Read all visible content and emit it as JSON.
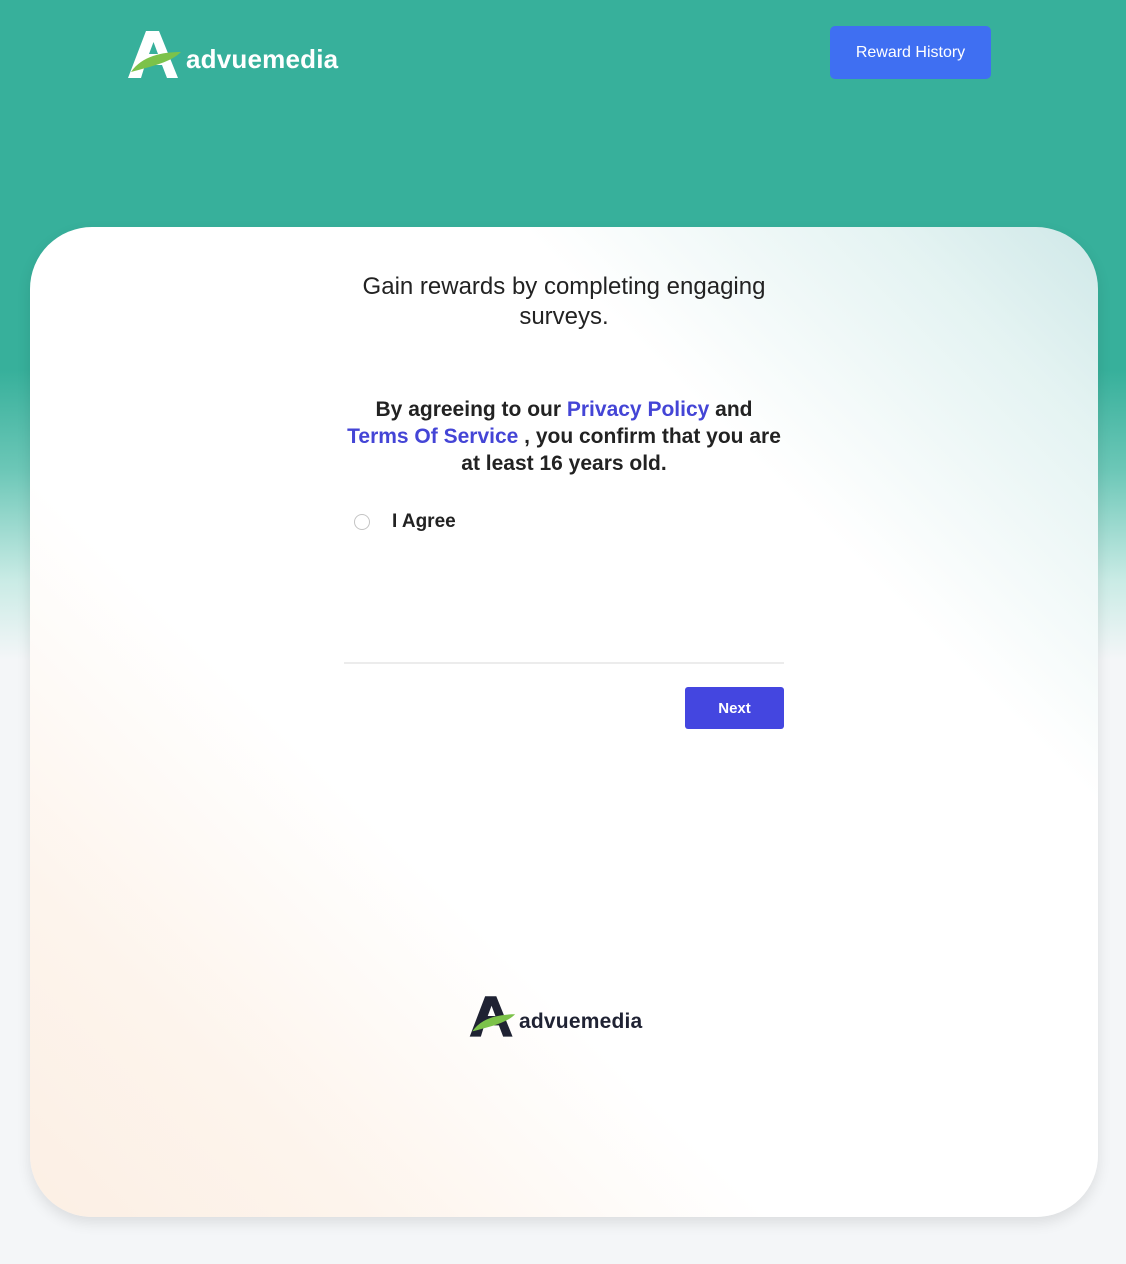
{
  "header": {
    "brand_name": "advuemedia",
    "reward_history_label": "Reward History"
  },
  "main": {
    "tagline": "Gain rewards by completing engaging surveys.",
    "consent": {
      "prefix": "By agreeing to our ",
      "privacy_link": "Privacy Policy",
      "middle": " and ",
      "terms_link": "Terms Of Service",
      "suffix": " , you confirm that you are at least 16 years old."
    },
    "agree_label": "I Agree",
    "agree_checked": false,
    "next_label": "Next"
  },
  "footer": {
    "brand_name": "advuemedia"
  },
  "colors": {
    "header_teal": "#37b09b",
    "reward_button": "#3f6ff2",
    "link": "#4445d6",
    "next_button": "#4446e0",
    "logo_leaf": "#7cc24a"
  },
  "icons": {
    "logo_mark": "letter-a-with-leaf-icon",
    "agree_radio": "radio-unchecked"
  }
}
